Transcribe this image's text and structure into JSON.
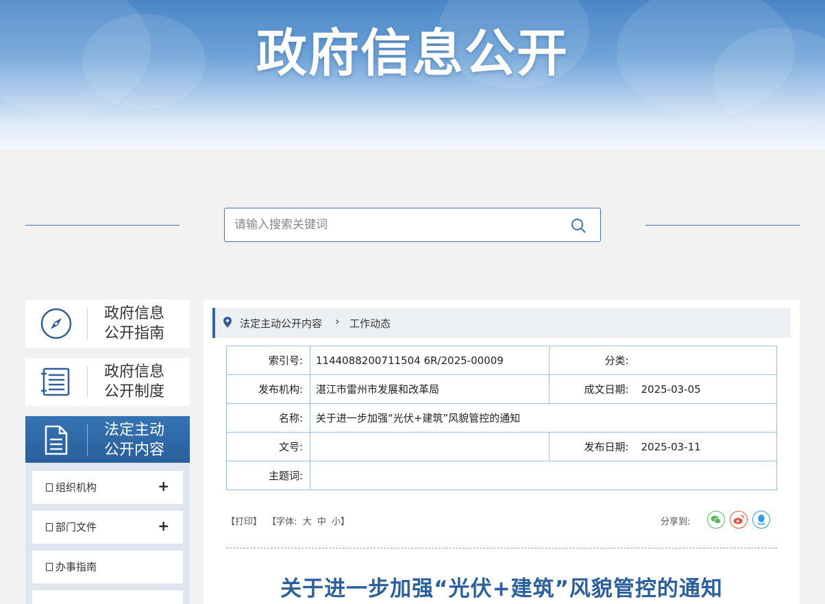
{
  "banner": {
    "title": "政府信息公开"
  },
  "search": {
    "placeholder": "请输入搜索关键词"
  },
  "nav": [
    {
      "label_line1": "政府信息",
      "label_line2": "公开指南",
      "icon": "compass-icon"
    },
    {
      "label_line1": "政府信息",
      "label_line2": "公开制度",
      "icon": "list-icon"
    },
    {
      "label_line1": "法定主动",
      "label_line2": "公开内容",
      "icon": "document-icon",
      "active": true
    }
  ],
  "sub_nav": [
    {
      "label": "组织机构",
      "expandable": "+"
    },
    {
      "label": "部门文件",
      "expandable": "+"
    },
    {
      "label": "办事指南"
    }
  ],
  "breadcrumb": {
    "item1": "法定主动公开内容",
    "separator": "›",
    "item2": "工作动态"
  },
  "meta": {
    "index_label": "索引号:",
    "index_value": "1144088200711504 6R/2025-00009",
    "category_label": "分类:",
    "category_value": "",
    "publisher_label": "发布机构:",
    "publisher_value": "湛江市雷州市发展和改革局",
    "date_written_label": "成文日期:",
    "date_written_value": "2025-03-05",
    "name_label": "名称:",
    "name_value": "关于进一步加强“光伏+建筑”风貌管控的通知",
    "doc_no_label": "文号:",
    "doc_no_value": "",
    "publish_date_label": "发布日期:",
    "publish_date_value": "2025-03-11",
    "keywords_label": "主题词:",
    "keywords_value": ""
  },
  "tools": {
    "print": "【打印】",
    "font_prefix": "【字体:",
    "font_large": "大",
    "font_medium": "中",
    "font_small": "小】"
  },
  "share": {
    "label": "分享到:",
    "wechat": "wechat-icon",
    "weibo": "weibo-icon",
    "qq": "qq-icon"
  },
  "article": {
    "title": "关于进一步加强“光伏+建筑”风貌管控的通知"
  },
  "colors": {
    "accent": "#2f68a8",
    "title": "#2b5f9e",
    "wechat": "#5cb85c",
    "weibo": "#e2583e",
    "qq": "#2f9ae0"
  }
}
